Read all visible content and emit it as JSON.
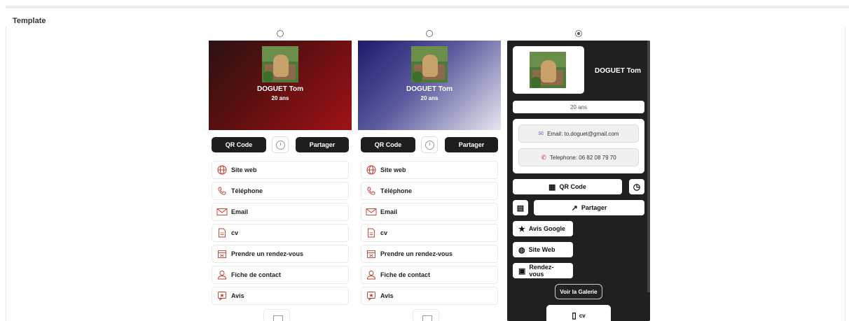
{
  "section_title": "Template",
  "person": {
    "name": "DOGUET Tom",
    "age": "20 ans"
  },
  "actions": {
    "qr_code": "QR Code",
    "partager": "Partager"
  },
  "links": [
    {
      "label": "Site web",
      "icon": "globe-icon"
    },
    {
      "label": "Téléphone",
      "icon": "phone-icon"
    },
    {
      "label": "Email",
      "icon": "email-icon"
    },
    {
      "label": "cv",
      "icon": "document-icon"
    },
    {
      "label": "Prendre un rendez-vous",
      "icon": "calendar-icon"
    },
    {
      "label": "Fiche de contact",
      "icon": "person-icon"
    },
    {
      "label": "Avis",
      "icon": "review-icon"
    }
  ],
  "templates": [
    {
      "selected": false
    },
    {
      "selected": false
    },
    {
      "selected": true
    }
  ],
  "dark_card": {
    "email": "Email: to.doguet@gmail.com",
    "telephone": "Telephone: 06 82 08 79 70",
    "qr_code": "QR Code",
    "partager": "Partager",
    "avis_google": "Avis Google",
    "site_web": "Site Web",
    "rendez_vous": "Rendez-vous",
    "galerie": "Voir la Galerie",
    "cv": "cv"
  },
  "colors": {
    "card1_gradient": [
      "#2b1212",
      "#a01217"
    ],
    "card2_gradient": [
      "#1d1b6b",
      "#e6e6ef"
    ],
    "dark_card_bg": "#202020",
    "button_dark": "#1e1e1e",
    "icon_accent": "#c0392b"
  }
}
